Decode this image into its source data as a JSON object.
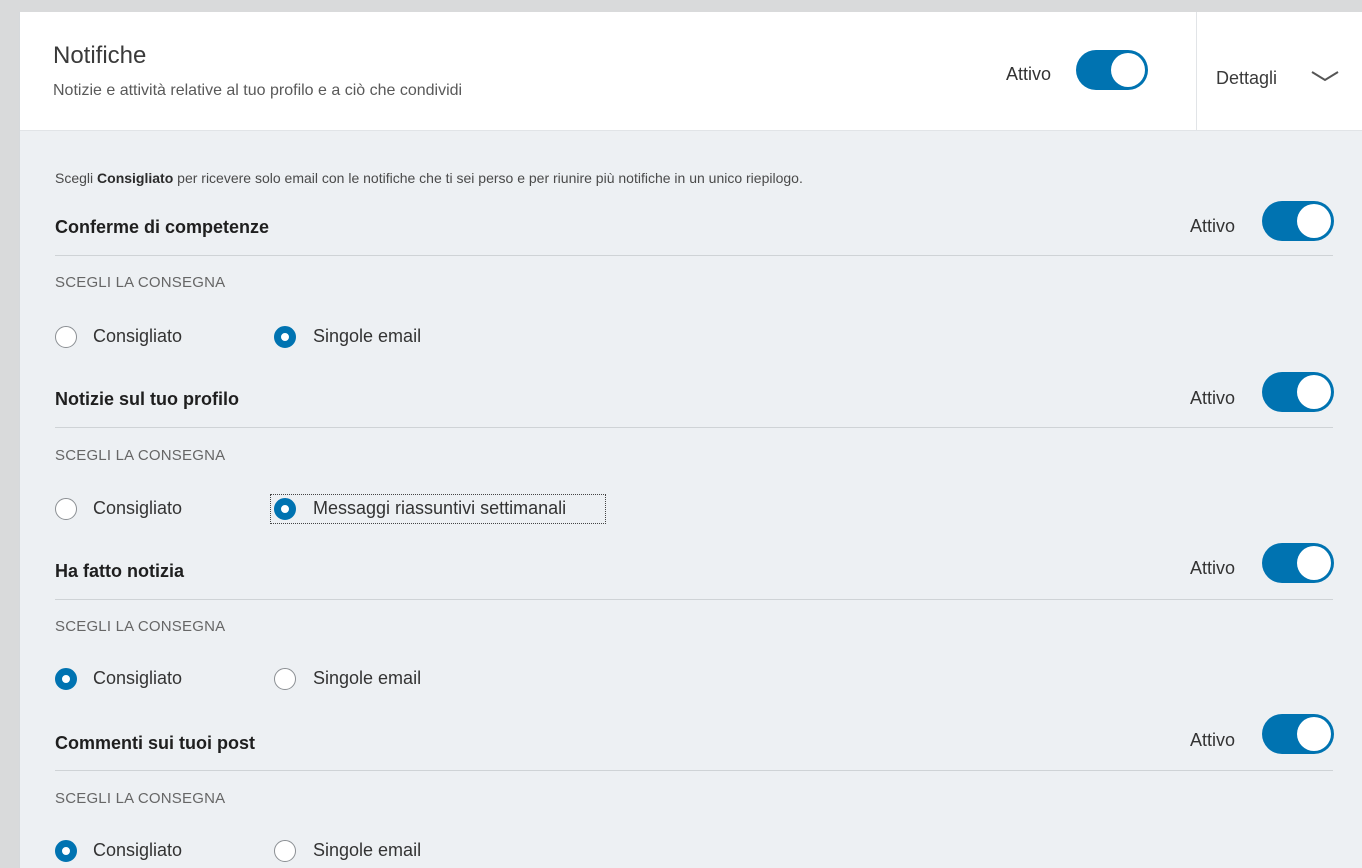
{
  "header": {
    "title": "Notifiche",
    "subtitle": "Notizie e attività relative al tuo profilo e a ciò che condividi",
    "status": "Attivo",
    "details_label": "Dettagli"
  },
  "intro": {
    "prefix": "Scegli ",
    "bold": "Consigliato",
    "suffix": " per ricevere solo email con le notifiche che ti sei perso e per riunire più notifiche in un unico riepilogo."
  },
  "sections": [
    {
      "title": "Conferme di competenze",
      "status": "Attivo",
      "caption": "SCEGLI LA CONSEGNA",
      "option_a": "Consigliato",
      "option_b": "Singole email",
      "selected": "b"
    },
    {
      "title": "Notizie sul tuo profilo",
      "status": "Attivo",
      "caption": "SCEGLI LA CONSEGNA",
      "option_a": "Consigliato",
      "option_b": "Messaggi riassuntivi settimanali",
      "selected": "b"
    },
    {
      "title": "Ha fatto notizia",
      "status": "Attivo",
      "caption": "SCEGLI LA CONSEGNA",
      "option_a": "Consigliato",
      "option_b": "Singole email",
      "selected": "a"
    },
    {
      "title": "Commenti sui tuoi post",
      "status": "Attivo",
      "caption": "SCEGLI LA CONSEGNA",
      "option_a": "Consigliato",
      "option_b": "Singole email",
      "selected": "a"
    }
  ],
  "colors": {
    "accent": "#0073b1",
    "background": "#edf0f3"
  }
}
